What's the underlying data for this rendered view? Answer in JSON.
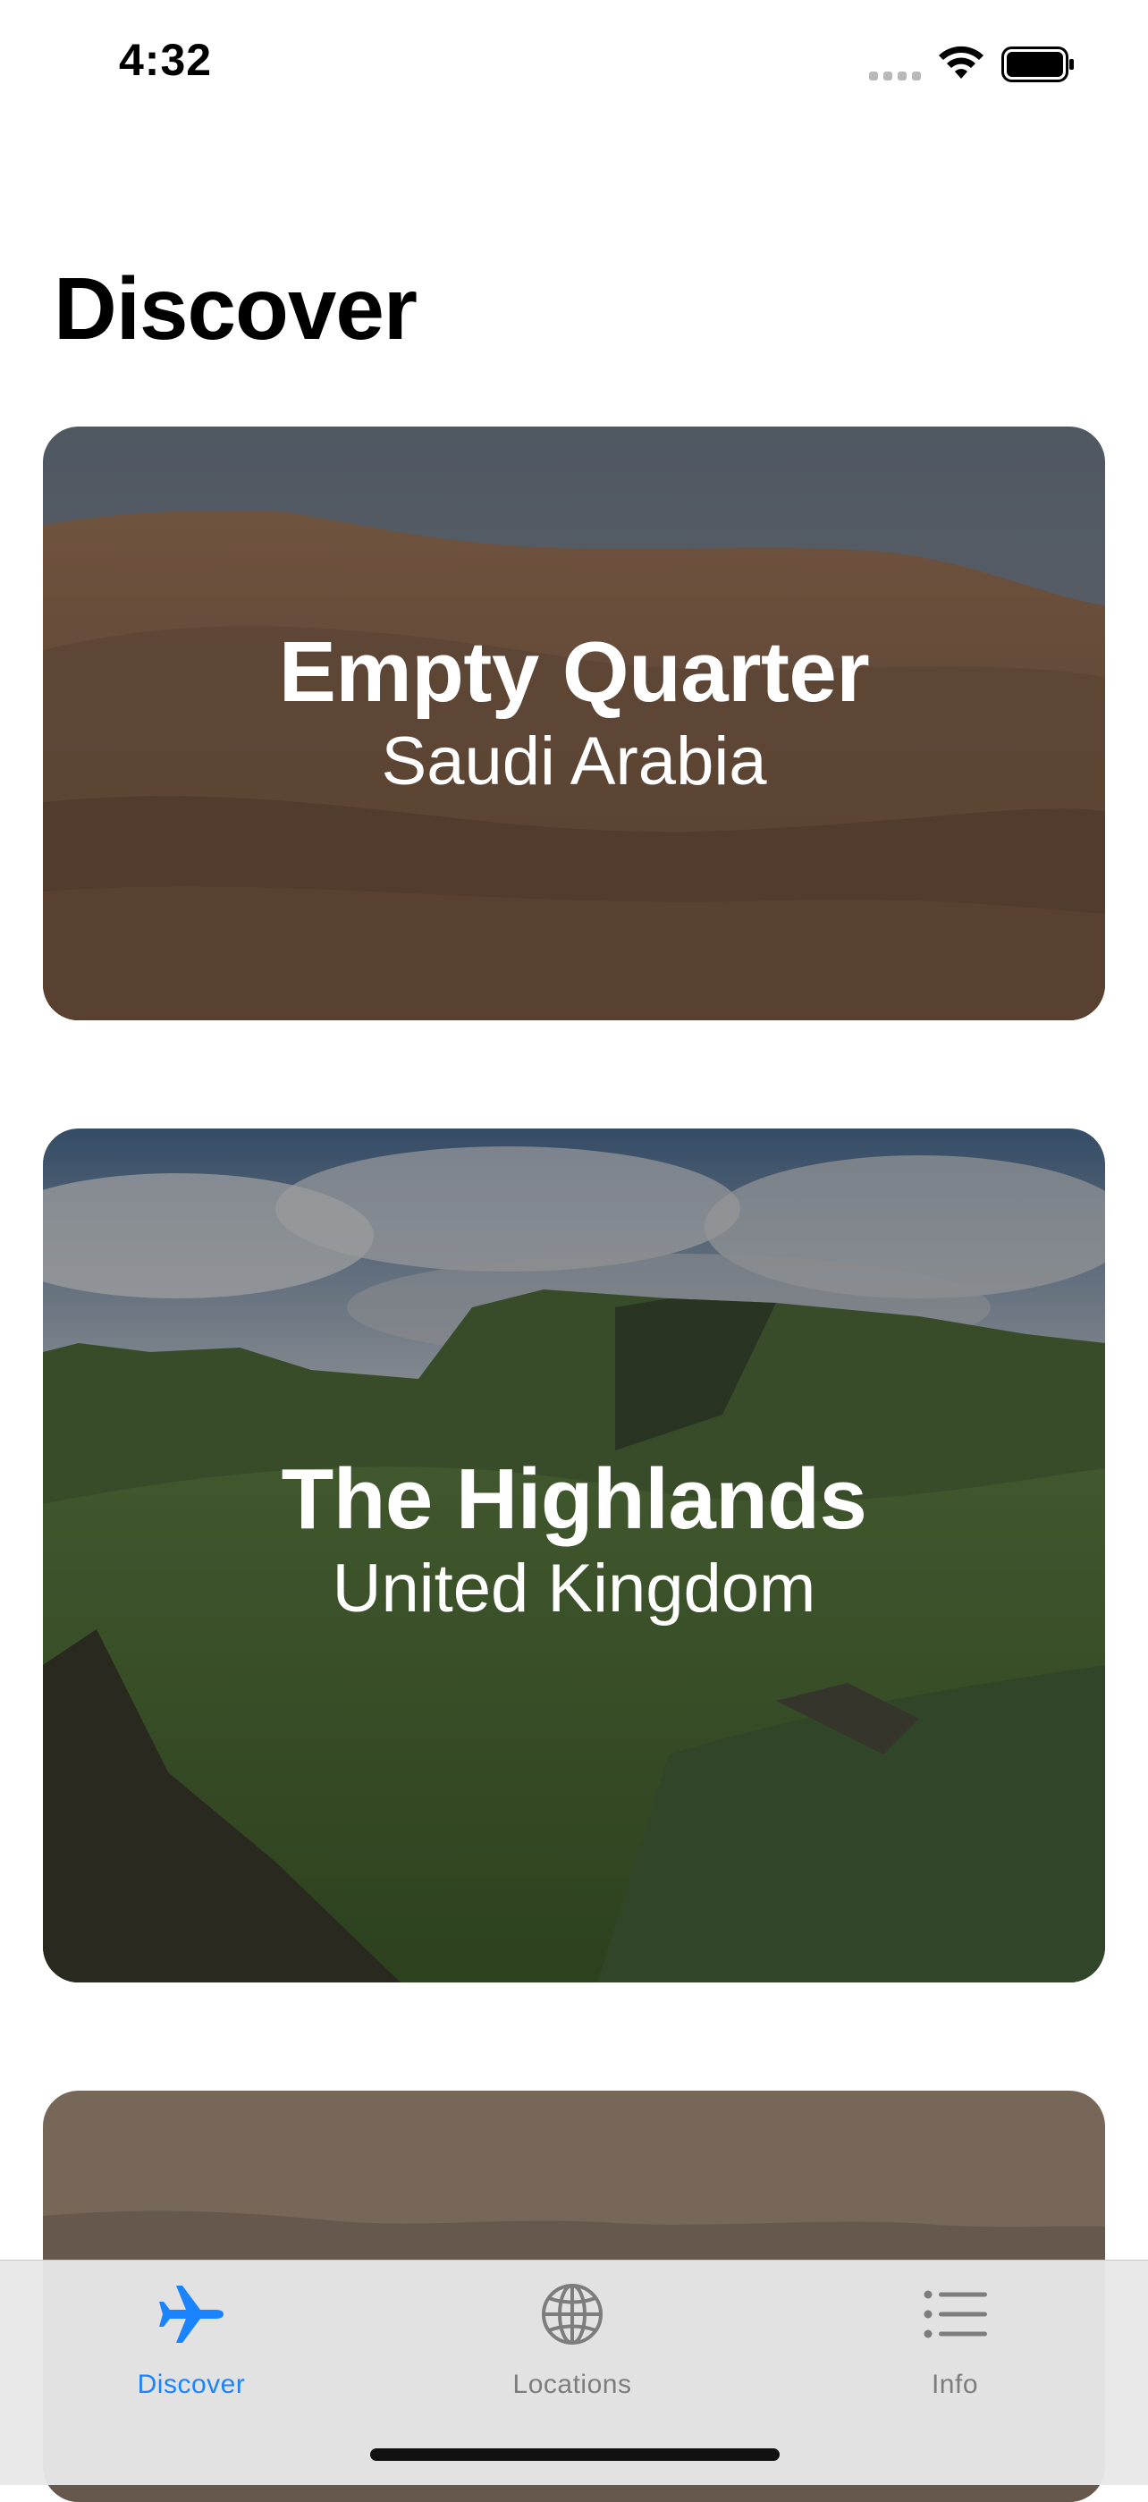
{
  "status_bar": {
    "time": "4:32",
    "icons": [
      "cellular-signal-icon",
      "wifi-icon",
      "battery-icon"
    ]
  },
  "page": {
    "title": "Discover"
  },
  "cards": [
    {
      "title": "Empty Quarter",
      "subtitle": "Saudi Arabia",
      "image": "desert-dunes"
    },
    {
      "title": "The Highlands",
      "subtitle": "United Kingdom",
      "image": "green-highlands"
    },
    {
      "title": "",
      "subtitle": "",
      "image": "hazy-landscape"
    }
  ],
  "tab_bar": {
    "tabs": [
      {
        "label": "Discover",
        "icon": "airplane-icon",
        "selected": true
      },
      {
        "label": "Locations",
        "icon": "globe-icon",
        "selected": false
      },
      {
        "label": "Info",
        "icon": "list-icon",
        "selected": false
      }
    ]
  },
  "colors": {
    "accent": "#1a84ff",
    "tab_inactive": "#7d7d7d"
  }
}
